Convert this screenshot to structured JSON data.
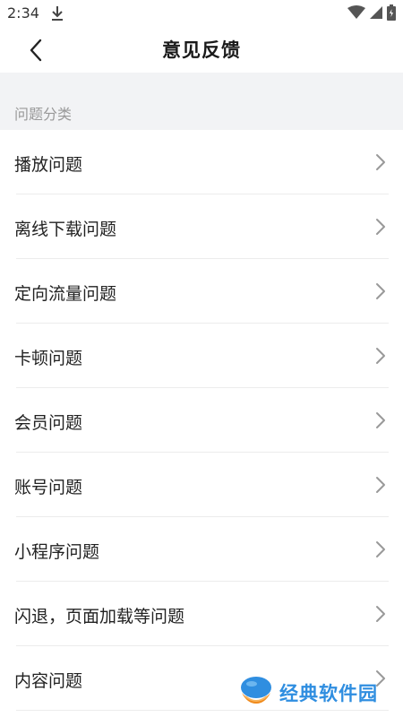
{
  "status_bar": {
    "time": "2:34",
    "icons": [
      "download-icon",
      "wifi-icon",
      "signal-icon",
      "battery-icon"
    ]
  },
  "header": {
    "title": "意见反馈",
    "back_icon": "chevron-left-icon"
  },
  "section": {
    "title": "问题分类"
  },
  "list": {
    "items": [
      {
        "label": "播放问题"
      },
      {
        "label": "离线下载问题"
      },
      {
        "label": "定向流量问题"
      },
      {
        "label": "卡顿问题"
      },
      {
        "label": "会员问题"
      },
      {
        "label": "账号问题"
      },
      {
        "label": "小程序问题"
      },
      {
        "label": "闪退，页面加载等问题"
      },
      {
        "label": "内容问题"
      }
    ]
  },
  "watermark": {
    "text": "经典软件园"
  },
  "colors": {
    "section_bg": "#f2f3f5",
    "section_text": "#999999",
    "divider": "#ececec",
    "watermark_blue": "#2f8ee0",
    "watermark_orange": "#f08a1c"
  }
}
